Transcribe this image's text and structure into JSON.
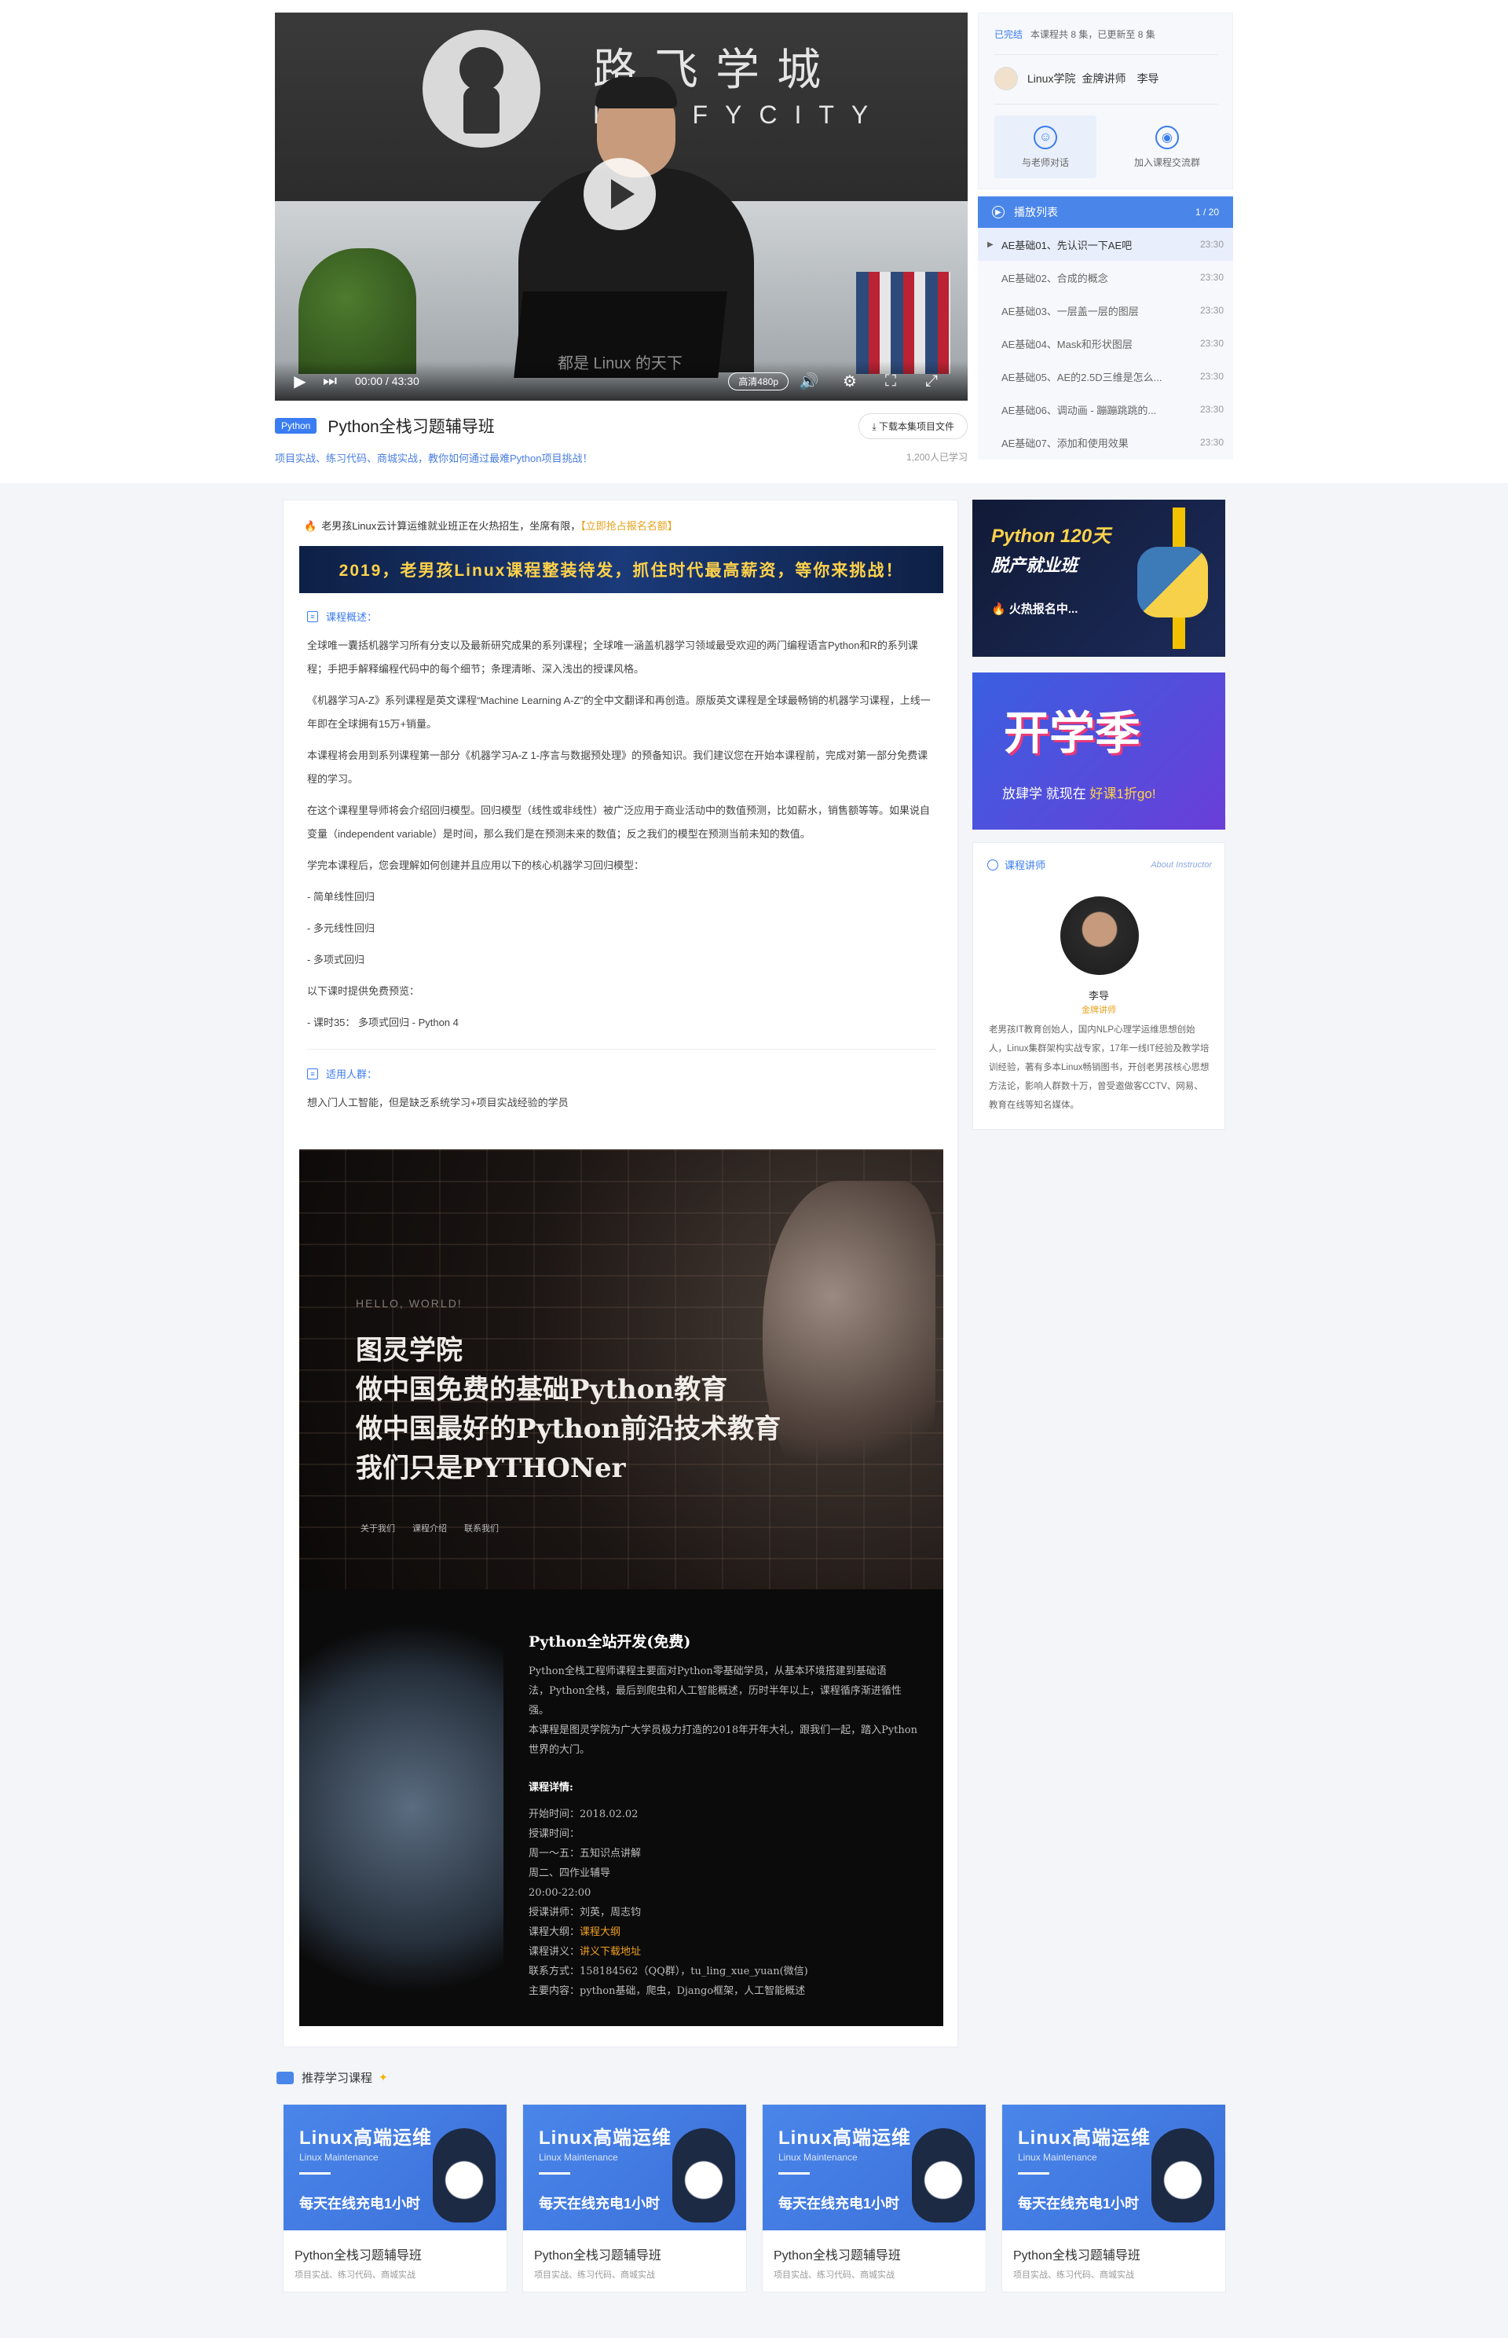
{
  "player": {
    "brand_cn": "路飞学城",
    "brand_en": "LUFFYCITY",
    "subtitle": "都是 Linux 的天下",
    "time": "00:00 / 43:30",
    "quality": "高清480p",
    "play_icon": "play-icon"
  },
  "course": {
    "tag": "Python",
    "title": "Python全栈习题辅导班",
    "download": "下载本集项目文件",
    "desc": "项目实战、练习代码、商城实战，教你如何通过最难Python项目挑战！",
    "learners": "1,200人已学习"
  },
  "panel": {
    "status_label": "已完结",
    "status_text": "本课程共 8 集，已更新至 8 集",
    "school": "Linux学院",
    "role": "金牌讲师",
    "teacher": "李导",
    "action1": "与老师对话",
    "action2": "加入课程交流群"
  },
  "playlist": {
    "title": "播放列表",
    "count": "1 / 20",
    "items": [
      {
        "label": "AE基础01、先认识一下AE吧",
        "dur": "23:30"
      },
      {
        "label": "AE基础02、合成的概念",
        "dur": "23:30"
      },
      {
        "label": "AE基础03、一层盖一层的图层",
        "dur": "23:30"
      },
      {
        "label": "AE基础04、Mask和形状图层",
        "dur": "23:30"
      },
      {
        "label": "AE基础05、AE的2.5D三维是怎么...",
        "dur": "23:30"
      },
      {
        "label": "AE基础06、调动画 - 蹦蹦跳跳的...",
        "dur": "23:30"
      },
      {
        "label": "AE基础07、添加和使用效果",
        "dur": "23:30"
      }
    ]
  },
  "main": {
    "notice": "老男孩Linux云计算运维就业班正在火热招生，坐席有限，",
    "notice_link": "【立即抢占报名名额】",
    "banner": "2019，老男孩Linux课程整装待发，抓住时代最高薪资，等你来挑战！",
    "overview_title": "课程概述：",
    "paras": [
      "全球唯一囊括机器学习所有分支以及最新研究成果的系列课程；全球唯一涵盖机器学习领域最受欢迎的两门编程语言Python和R的系列课程；手把手解释编程代码中的每个细节；条理清晰、深入浅出的授课风格。",
      "《机器学习A-Z》系列课程是英文课程“Machine Learning A-Z”的全中文翻译和再创造。原版英文课程是全球最畅销的机器学习课程，上线一年即在全球拥有15万+销量。",
      "本课程将会用到系列课程第一部分《机器学习A-Z 1-序言与数据预处理》的预备知识。我们建议您在开始本课程前，完成对第一部分免费课程的学习。",
      "在这个课程里导师将会介绍回归模型。回归模型（线性或非线性）被广泛应用于商业活动中的数值预测，比如薪水，销售额等等。如果说自变量（independent variable）是时间，那么我们是在预测未来的数值；反之我们的模型在预测当前未知的数值。",
      "学完本课程后，您会理解如何创建并且应用以下的核心机器学习回归模型：",
      "- 简单线性回归",
      "- 多元线性回归",
      "- 多项式回归",
      "以下课时提供免费预览：",
      "- 课时35： 多项式回归 - Python 4"
    ],
    "audience_title": "适用人群：",
    "audience": "想入门人工智能，但是缺乏系统学习+项目实战经验的学员"
  },
  "poster": {
    "hello": "HELLO, WORLD!",
    "lines": [
      "图灵学院",
      "做中国免费的基础Python教育",
      "做中国最好的Python前沿技术教育",
      "我们只是PYTHONer"
    ],
    "nav": [
      "关于我们",
      "课程介绍",
      "联系我们"
    ],
    "section_title": "Python全站开发(免费)",
    "intro": [
      "Python全栈工程师课程主要面对Python零基础学员，从基本环境搭建到基础语",
      "法，Python全栈，最后到爬虫和人工智能概述，历时半年以上，课程循序渐进循性",
      "强。",
      "本课程是图灵学院为广大学员极力打造的2018年开年大礼，跟我们一起，踏入Python",
      "世界的大门。"
    ],
    "details_title": "课程详情:",
    "details": [
      "开始时间：2018.02.02",
      "授课时间：",
      "周一～五：五知识点讲解",
      "周二、四作业辅导",
      "20:00-22:00",
      "授课讲师：刘英，周志钧"
    ],
    "outline_label": "课程大纲：",
    "outline_link": "课程大纲",
    "handout_label": "课程讲义：",
    "handout_link": "讲义下载地址",
    "contact": "联系方式：158184562（QQ群），tu_ling_xue_yuan(微信)",
    "content": "主要内容：python基础，爬虫，Django框架，人工智能概述"
  },
  "ads": {
    "ad1_line1": "Python 120天",
    "ad1_line2": "脱产就业班",
    "ad1_line3": "火热报名中...",
    "ad2_big": "开学季",
    "ad2_small_pre": "放肆学 就现在 ",
    "ad2_small_hl": "好课1折go!"
  },
  "instructor": {
    "title": "课程讲师",
    "en": "About Instructor",
    "name": "李导",
    "rank": "金牌讲师",
    "bio": "老男孩IT教育创始人，国内NLP心理学运维思想创始人，Linux集群架构实战专家，17年一线IT经验及教学培训经验，著有多本Linux畅销图书，开创老男孩核心思想方法论，影响人群数十万，曾受邀做客CCTV、网易、教育在线等知名媒体。"
  },
  "recommended": {
    "title": "推荐学习课程",
    "cards": [
      {
        "img_t1": "Linux高端运维",
        "img_t2": "Linux Maintenance",
        "img_t3": "每天在线充电1小时",
        "title": "Python全栈习题辅导班",
        "desc": "项目实战、练习代码、商城实战"
      },
      {
        "img_t1": "Linux高端运维",
        "img_t2": "Linux Maintenance",
        "img_t3": "每天在线充电1小时",
        "title": "Python全栈习题辅导班",
        "desc": "项目实战、练习代码、商城实战"
      },
      {
        "img_t1": "Linux高端运维",
        "img_t2": "Linux Maintenance",
        "img_t3": "每天在线充电1小时",
        "title": "Python全栈习题辅导班",
        "desc": "项目实战、练习代码、商城实战"
      },
      {
        "img_t1": "Linux高端运维",
        "img_t2": "Linux Maintenance",
        "img_t3": "每天在线充电1小时",
        "title": "Python全栈习题辅导班",
        "desc": "项目实战、练习代码、商城实战"
      }
    ]
  }
}
